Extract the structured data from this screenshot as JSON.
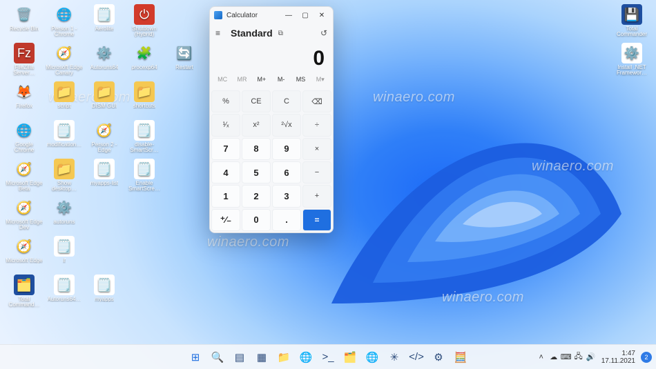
{
  "watermark": "winaero.com",
  "desktop": {
    "left_icons": [
      [
        {
          "name": "recycle-bin",
          "label": "Recycle Bin",
          "glyph": "🗑️",
          "bg": ""
        },
        {
          "name": "person1-chrome",
          "label": "Person 1 - Chrome",
          "glyph": "🌐",
          "bg": ""
        },
        {
          "name": "aerolite",
          "label": "Aerolite",
          "glyph": "🗒️",
          "bg": "#fff"
        },
        {
          "name": "shutdown-hybrid",
          "label": "Shutdown (Hybrid)",
          "glyph": "⏻",
          "bg": "#d23b2b"
        }
      ],
      [
        {
          "name": "filezilla-server",
          "label": "FileZilla Server…",
          "glyph": "Fz",
          "bg": "#c0392b"
        },
        {
          "name": "edge-canary",
          "label": "Microsoft Edge Canary",
          "glyph": "🧭",
          "bg": ""
        },
        {
          "name": "autoruns64",
          "label": "Autoruns64",
          "glyph": "⚙️",
          "bg": ""
        },
        {
          "name": "procexp64",
          "label": "procexp64",
          "glyph": "🧩",
          "bg": ""
        },
        {
          "name": "restart",
          "label": "Restart",
          "glyph": "🔄",
          "bg": ""
        }
      ],
      [
        {
          "name": "firefox",
          "label": "Firefox",
          "glyph": "🦊",
          "bg": ""
        },
        {
          "name": "script",
          "label": "script",
          "glyph": "📁",
          "bg": "#f5c852"
        },
        {
          "name": "dism-gui",
          "label": "DISM GUI",
          "glyph": "📁",
          "bg": "#f5c852"
        },
        {
          "name": "shortcuts",
          "label": "shortcuts",
          "glyph": "📁",
          "bg": "#f5c852"
        }
      ],
      [
        {
          "name": "google-chrome",
          "label": "Google Chrome",
          "glyph": "🌐",
          "bg": ""
        },
        {
          "name": "modification",
          "label": "modification…",
          "glyph": "🗒️",
          "bg": "#fff"
        },
        {
          "name": "person2-edge",
          "label": "Person 2 - Edge",
          "glyph": "🧭",
          "bg": ""
        },
        {
          "name": "disable-smartscreen",
          "label": "disable-SmartScr…",
          "glyph": "🗒️",
          "bg": "#fff"
        }
      ],
      [
        {
          "name": "edge-beta",
          "label": "Microsoft Edge Beta",
          "glyph": "🧭",
          "bg": ""
        },
        {
          "name": "show-desktop",
          "label": "Show desktop…",
          "glyph": "📁",
          "bg": "#f5c852"
        },
        {
          "name": "myapps-list",
          "label": "myapps-list",
          "glyph": "🗒️",
          "bg": "#fff"
        },
        {
          "name": "enable-smartscreen",
          "label": "Enable SmartScre…",
          "glyph": "🗒️",
          "bg": "#fff"
        }
      ],
      [
        {
          "name": "edge-dev",
          "label": "Microsoft Edge Dev",
          "glyph": "🧭",
          "bg": ""
        },
        {
          "name": "autoruns",
          "label": "autoruns",
          "glyph": "⚙️",
          "bg": ""
        }
      ],
      [
        {
          "name": "edge",
          "label": "Microsoft Edge",
          "glyph": "🧭",
          "bg": ""
        },
        {
          "name": "if",
          "label": "if",
          "glyph": "🗒️",
          "bg": "#fff"
        }
      ],
      [
        {
          "name": "total-commander",
          "label": "Total Command…",
          "glyph": "🗂️",
          "bg": "#1f4fa0"
        },
        {
          "name": "autoruns64-2",
          "label": "Autoruns64…",
          "glyph": "🗒️",
          "bg": "#fff"
        },
        {
          "name": "myapps",
          "label": "myapps",
          "glyph": "🗒️",
          "bg": "#fff"
        }
      ]
    ],
    "right_icons": [
      {
        "name": "total-commander-r",
        "label": "Total Commander",
        "glyph": "💾",
        "bg": "#1f4fa0"
      },
      {
        "name": "install-net",
        "label": "Install .NET Framewor…",
        "glyph": "⚙️",
        "bg": "#fff"
      }
    ]
  },
  "calculator": {
    "title": "Calculator",
    "mode": "Standard",
    "value": "0",
    "mem": [
      "MC",
      "MR",
      "M+",
      "M-",
      "MS",
      "M▾"
    ],
    "mem_enabled": [
      false,
      false,
      true,
      true,
      true,
      false
    ],
    "keys": [
      {
        "t": "%",
        "c": "func"
      },
      {
        "t": "CE",
        "c": "func"
      },
      {
        "t": "C",
        "c": "func"
      },
      {
        "t": "⌫",
        "c": "func"
      },
      {
        "t": "¹⁄ₓ",
        "c": "func"
      },
      {
        "t": "x²",
        "c": "func"
      },
      {
        "t": "²√x",
        "c": "func"
      },
      {
        "t": "÷",
        "c": "func"
      },
      {
        "t": "7",
        "c": "num"
      },
      {
        "t": "8",
        "c": "num"
      },
      {
        "t": "9",
        "c": "num"
      },
      {
        "t": "×",
        "c": "func"
      },
      {
        "t": "4",
        "c": "num"
      },
      {
        "t": "5",
        "c": "num"
      },
      {
        "t": "6",
        "c": "num"
      },
      {
        "t": "−",
        "c": "func"
      },
      {
        "t": "1",
        "c": "num"
      },
      {
        "t": "2",
        "c": "num"
      },
      {
        "t": "3",
        "c": "num"
      },
      {
        "t": "+",
        "c": "func"
      },
      {
        "t": "⁺∕₋",
        "c": "num"
      },
      {
        "t": "0",
        "c": "num"
      },
      {
        "t": ".",
        "c": "num"
      },
      {
        "t": "=",
        "c": "eq"
      }
    ]
  },
  "taskbar": {
    "center": [
      {
        "name": "start",
        "glyph": "⊞",
        "color": "#1f6fe0"
      },
      {
        "name": "search",
        "glyph": "🔍"
      },
      {
        "name": "task-view",
        "glyph": "▤"
      },
      {
        "name": "widgets",
        "glyph": "▦"
      },
      {
        "name": "file-explorer",
        "glyph": "📁"
      },
      {
        "name": "edge",
        "glyph": "🌐"
      },
      {
        "name": "terminal",
        "glyph": ">_"
      },
      {
        "name": "total-commander",
        "glyph": "🗂️"
      },
      {
        "name": "chrome",
        "glyph": "🌐"
      },
      {
        "name": "winaero",
        "glyph": "✳"
      },
      {
        "name": "vscode",
        "glyph": "</>"
      },
      {
        "name": "settings",
        "glyph": "⚙"
      },
      {
        "name": "calculator",
        "glyph": "🧮"
      }
    ],
    "tray": [
      {
        "name": "chevron",
        "glyph": "˄"
      },
      {
        "name": "onedrive",
        "glyph": "☁"
      },
      {
        "name": "language",
        "glyph": "⌨"
      },
      {
        "name": "network",
        "glyph": "🖧"
      },
      {
        "name": "volume",
        "glyph": "🔊"
      }
    ],
    "time": "1:47",
    "date": "17.11.2021",
    "notif_count": "2"
  }
}
